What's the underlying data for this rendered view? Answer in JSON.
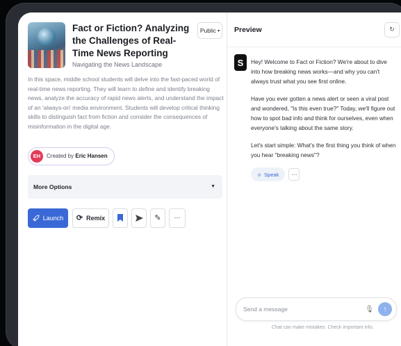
{
  "activity": {
    "title": "Fact or Fiction? Analyzing the Challenges of Real-Time News Reporting",
    "subtitle": "Navigating the News Landscape",
    "visibility": "Public",
    "description": "In this space, middle school students will delve into the fast-paced world of real-time news reporting. They will learn to define and identify breaking news, analyze the accuracy of rapid news alerts, and understand the impact of an 'always-on' media environment. Students will develop critical thinking skills to distinguish fact from fiction and consider the consequences of misinformation in the digital age.",
    "creator_prefix": "Created by",
    "creator_name": "Eric Hansen",
    "creator_initials": "EH"
  },
  "more_options": {
    "label": "More Options"
  },
  "actions": {
    "launch": "Launch",
    "remix": "Remix"
  },
  "preview": {
    "title": "Preview",
    "messages": [
      "Hey! Welcome to Fact or Fiction? We're about to dive into how breaking news works—and why you can't always trust what you see first online.",
      "Have you ever gotten a news alert or seen a viral post and wondered, \"Is this even true?\" Today, we'll figure out how to spot bad info and think for ourselves, even when everyone's talking about the same story.",
      "Let's start simple: What's the first thing you think of when you hear \"breaking news\"?"
    ],
    "speak_label": "Speak",
    "composer_placeholder": "Send a message",
    "disclaimer": "Chat can make mistakes. Check important info."
  },
  "colors": {
    "accent": "#3a68d6",
    "avatar": "#e23b5a"
  }
}
